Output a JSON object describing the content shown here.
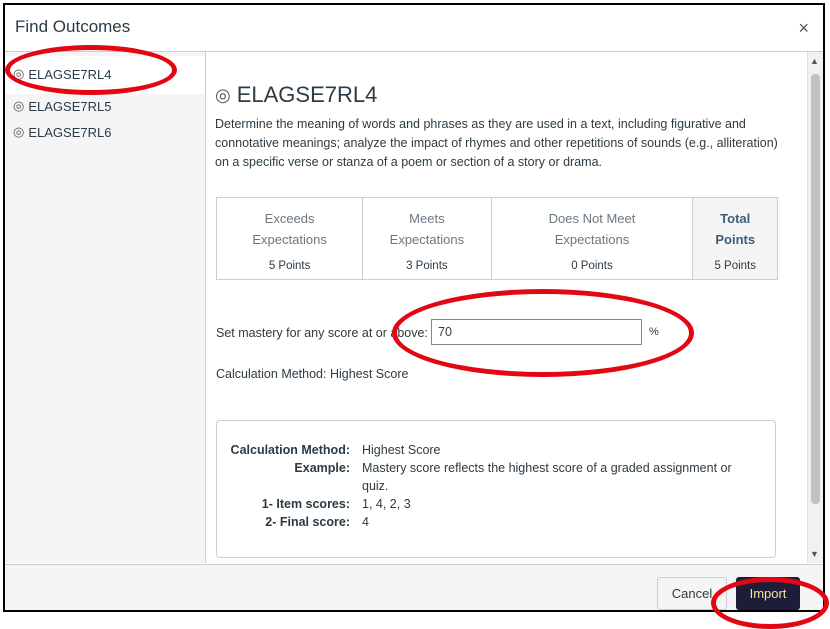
{
  "dialog": {
    "title": "Find Outcomes",
    "close_glyph": "×"
  },
  "sidebar": {
    "items": [
      {
        "label": "ELAGSE7RL4",
        "selected": true
      },
      {
        "label": "ELAGSE7RL5",
        "selected": false
      },
      {
        "label": "ELAGSE7RL6",
        "selected": false
      }
    ]
  },
  "outcome": {
    "title": "ELAGSE7RL4",
    "description": "Determine the meaning of words and phrases as they are used in a text, including figurative and connotative meanings; analyze the impact of rhymes and other repetitions of sounds (e.g., alliteration) on a specific verse or stanza of a poem or section of a story or drama."
  },
  "rubric": {
    "columns": [
      {
        "line1": "Exceeds",
        "line2": "Expectations",
        "points": "5 Points"
      },
      {
        "line1": "Meets",
        "line2": "Expectations",
        "points": "3 Points"
      },
      {
        "line1": "Does Not Meet",
        "line2": "Expectations",
        "points": "0 Points"
      },
      {
        "line1": "Total",
        "line2": "Points",
        "points": "5 Points"
      }
    ]
  },
  "mastery": {
    "label": "Set mastery for any score at or above:",
    "value": "70",
    "unit": "%"
  },
  "calculation": {
    "label": "Calculation Method: Highest Score",
    "rows": [
      {
        "key": "Calculation Method:",
        "value": "Highest Score"
      },
      {
        "key": "Example:",
        "value": "Mastery score reflects the highest score of a graded assignment or quiz."
      },
      {
        "key": "1- Item scores:",
        "value": "1, 4, 2, 3"
      },
      {
        "key": "2- Final score:",
        "value": "4"
      }
    ]
  },
  "footer": {
    "cancel_label": "Cancel",
    "import_label": "Import"
  },
  "colors": {
    "annotation": "#e30613",
    "import_bg": "#1d1d3a"
  }
}
